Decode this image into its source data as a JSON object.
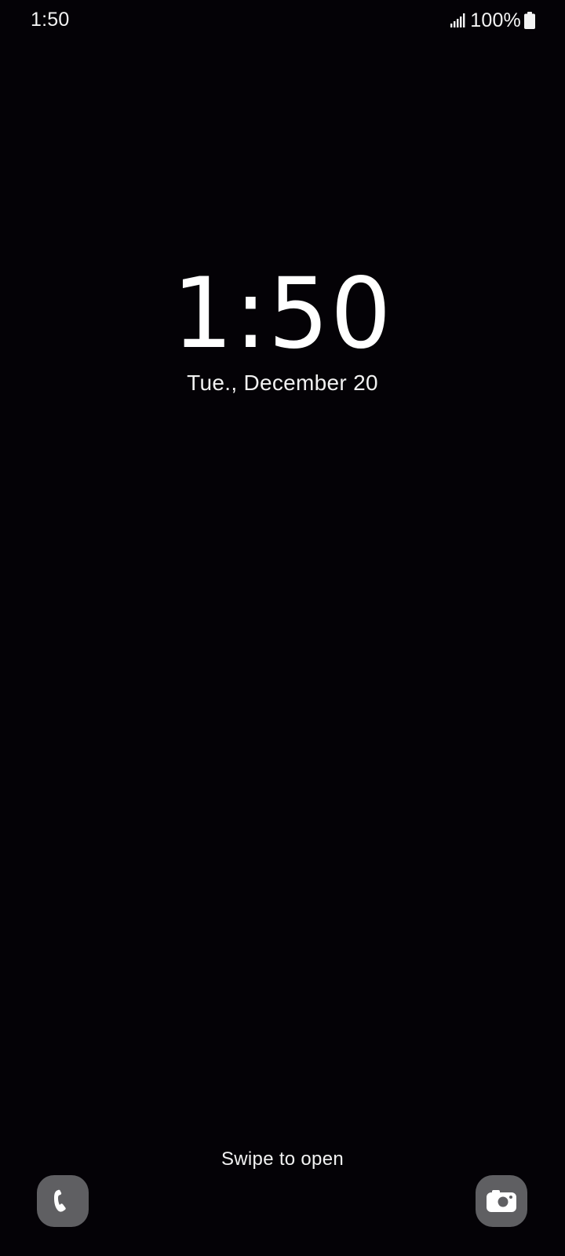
{
  "status_bar": {
    "time": "1:50",
    "battery_percent": "100%",
    "signal_icon": "signal-bars-icon",
    "battery_icon": "battery-full-icon"
  },
  "lock_screen": {
    "clock": "1:50",
    "date": "Tue., December 20",
    "swipe_hint": "Swipe to open"
  },
  "shortcuts": {
    "left_icon": "phone-icon",
    "right_icon": "camera-icon"
  },
  "colors": {
    "background": "#040206",
    "text": "#ffffff",
    "shortcut_bg": "#5f5f62"
  }
}
